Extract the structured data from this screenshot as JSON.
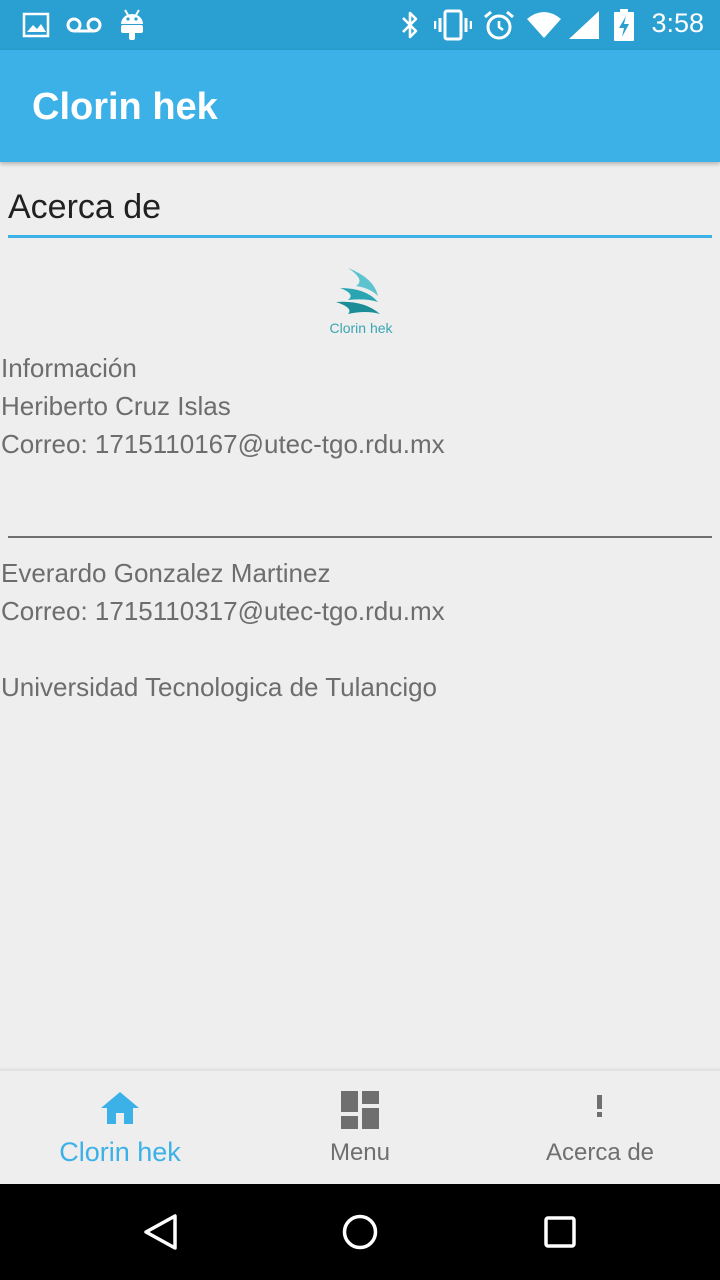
{
  "status_bar": {
    "time": "3:58",
    "left_icons": [
      "image-icon",
      "voicemail-icon",
      "android-icon"
    ],
    "right_icons": [
      "bluetooth-icon",
      "vibrate-icon",
      "alarm-icon",
      "wifi-icon",
      "signal-icon",
      "battery-icon"
    ]
  },
  "app_bar": {
    "title": "Clorin hek"
  },
  "content": {
    "section_title": "Acerca de",
    "logo_text": "Clorin hek",
    "info_heading": "Información",
    "person1_name": "Heriberto Cruz Islas",
    "person1_email": "Correo: 1715110167@utec-tgo.rdu.mx",
    "person2_name": "Everardo Gonzalez Martinez",
    "person2_email": "Correo: 1715110317@utec-tgo.rdu.mx",
    "university": "Universidad Tecnologica de Tulancigo"
  },
  "bottom_nav": {
    "items": [
      {
        "label": "Clorin hek",
        "icon": "home-icon",
        "active": true
      },
      {
        "label": "Menu",
        "icon": "dashboard-icon",
        "active": false
      },
      {
        "label": "Acerca de",
        "icon": "exclamation-icon",
        "active": false
      }
    ]
  },
  "system_nav": {
    "buttons": [
      "back-icon",
      "home-circle-icon",
      "recents-icon"
    ]
  },
  "colors": {
    "primary": "#3cb1e8",
    "status_bar": "#2a9fd1",
    "background": "#eeeeee",
    "text_secondary": "#757575"
  }
}
